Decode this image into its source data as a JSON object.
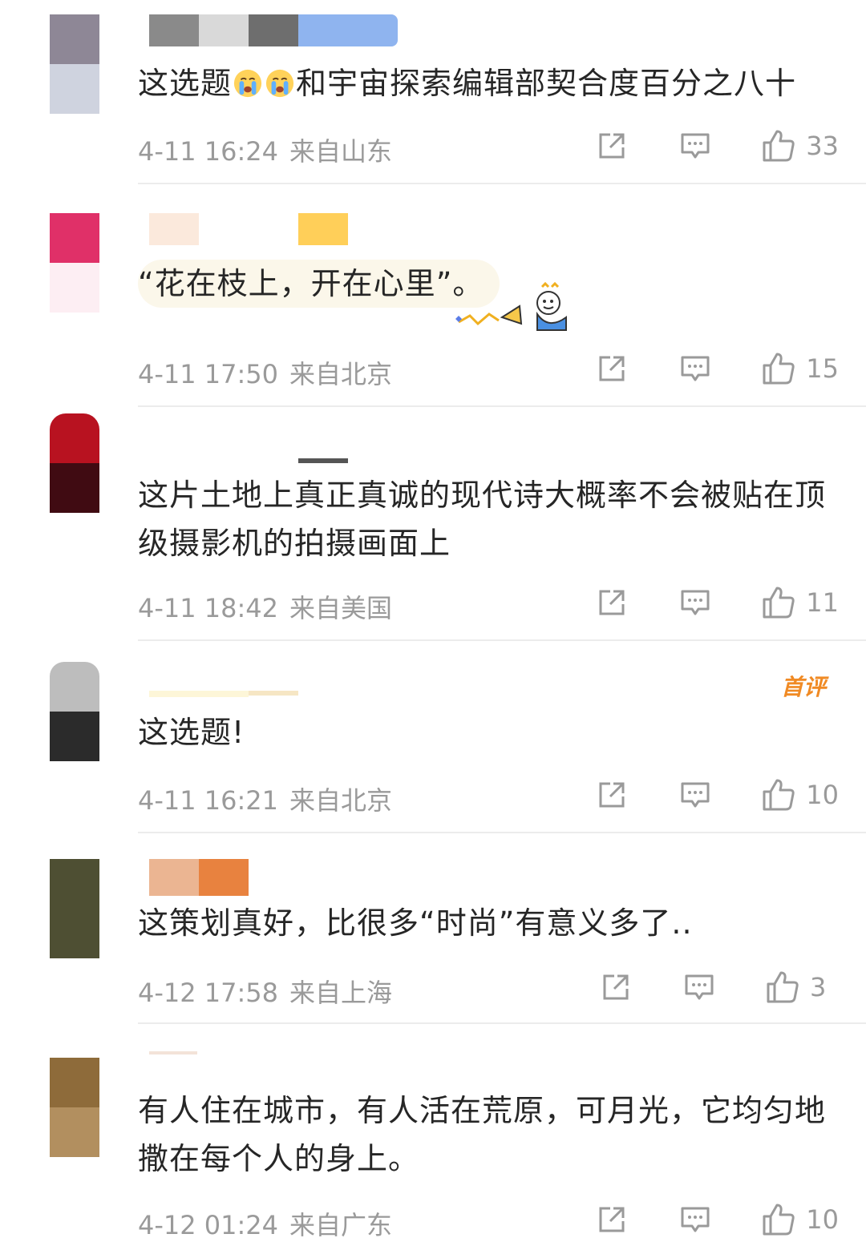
{
  "comments": [
    {
      "content_before_emoji": "这选题",
      "emoji": [
        "crying-face",
        "crying-face"
      ],
      "content": "和宇宙探索编辑部契合度百分之八十",
      "time": "4-11 16:24",
      "location": "来自山东",
      "likes": "33",
      "avatar_colors": [
        "#8e8796",
        "#cfd3df"
      ],
      "name_colors": [
        "#8a8a8a",
        "#d9d9d9",
        "#6e6e6e",
        "#8fb4ef"
      ]
    },
    {
      "content": "“花在枝上，开在心里”。",
      "time": "4-11 17:50",
      "location": "来自北京",
      "likes": "15",
      "avatar_colors": [
        "#e03068",
        "#fdeef3"
      ],
      "name_colors": [
        "#fbe9dc",
        "#ffffff",
        "#ffcf59"
      ]
    },
    {
      "content": "这片土地上真正真诚的现代诗大概率不会被贴在顶级摄影机的拍摄画面上",
      "time": "4-11 18:42",
      "location": "来自美国",
      "likes": "11",
      "avatar_colors": [
        "#b81220",
        "#400b12"
      ]
    },
    {
      "content": "这选题!",
      "time": "4-11 16:21",
      "location": "来自北京",
      "likes": "10",
      "badge": "首评",
      "avatar_colors": [
        "#bdbdbd",
        "#2b2b2b"
      ]
    },
    {
      "content": "这策划真好，比很多“时尚”有意义多了..",
      "time": "4-12 17:58",
      "location": "来自上海",
      "likes": "3",
      "avatar_colors": [
        "#4e4f33",
        "#4e4f33"
      ],
      "name_colors": [
        "#ebb592",
        "#e8823f"
      ]
    },
    {
      "content": "有人住在城市，有人活在荒原，可月光，它均匀地撒在每个人的身上。",
      "time": "4-12 01:24",
      "location": "来自广东",
      "likes": "10",
      "avatar_colors": [
        "#8e6b3a",
        "#b28f5f"
      ]
    }
  ]
}
